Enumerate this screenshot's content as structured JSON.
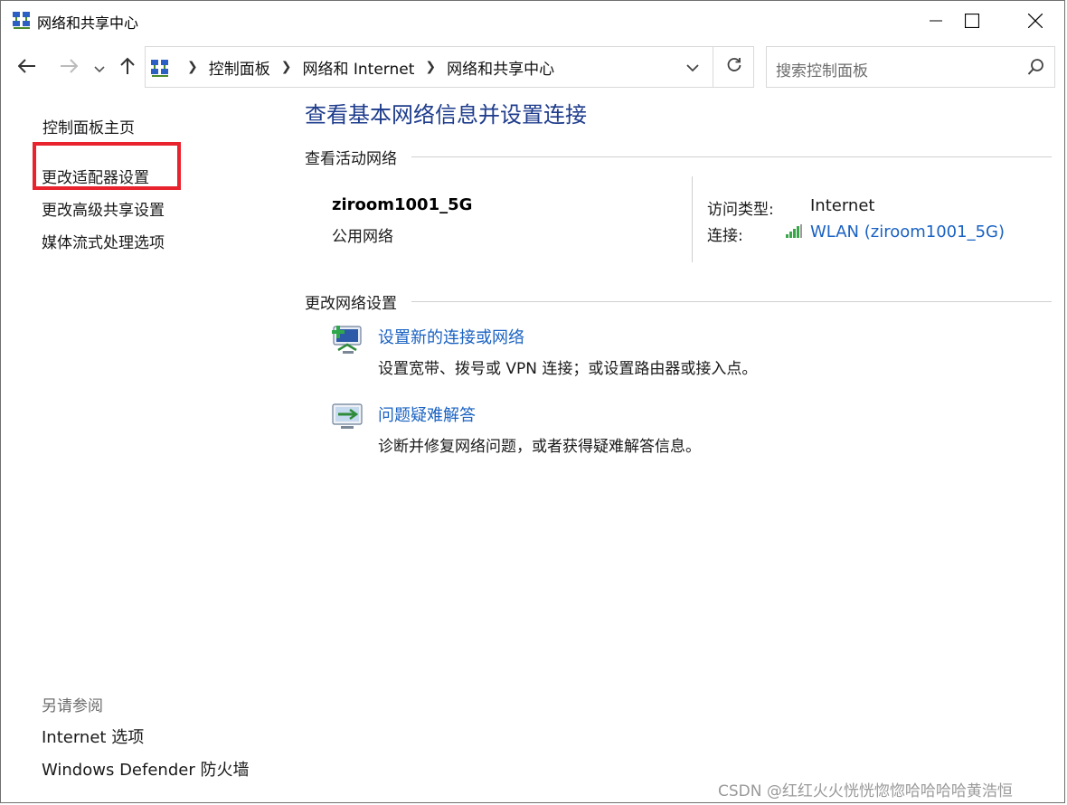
{
  "window": {
    "title": "网络和共享中心",
    "icon": "network-sharing-icon"
  },
  "navigation": {
    "back_icon": "arrow-left-icon",
    "forward_icon": "arrow-right-icon",
    "recent_icon": "chevron-down-icon",
    "up_icon": "arrow-up-icon"
  },
  "address": {
    "breadcrumbs": [
      "控制面板",
      "网络和 Internet",
      "网络和共享中心"
    ]
  },
  "search": {
    "placeholder": "搜索控制面板"
  },
  "left_nav": {
    "home": "控制面板主页",
    "adapter": "更改适配器设置",
    "advanced_sharing": "更改高级共享设置",
    "media_streaming": "媒体流式处理选项",
    "see_also_heading": "另请参阅",
    "internet_options": "Internet 选项",
    "defender_firewall": "Windows Defender 防火墙",
    "highlight_color": "#e8232d"
  },
  "main": {
    "title": "查看基本网络信息并设置连接",
    "active_networks_heading": "查看活动网络",
    "network": {
      "name": "ziroom1001_5G",
      "type": "公用网络",
      "access_type_label": "访问类型:",
      "access_type_value": "Internet",
      "connection_label": "连接:",
      "connection_value": "WLAN (ziroom1001_5G)"
    },
    "change_settings_heading": "更改网络设置",
    "tasks": [
      {
        "icon": "new-connection-icon",
        "link": "设置新的连接或网络",
        "description": "设置宽带、拨号或 VPN 连接；或设置路由器或接入点。"
      },
      {
        "icon": "troubleshoot-icon",
        "link": "问题疑难解答",
        "description": "诊断并修复网络问题，或者获得疑难解答信息。"
      }
    ]
  },
  "watermark": "CSDN @红红火火恍恍惚惚哈哈哈哈黄浩恒",
  "colors": {
    "title_blue": "#1e3c8c",
    "link_blue": "#1a62c2"
  }
}
